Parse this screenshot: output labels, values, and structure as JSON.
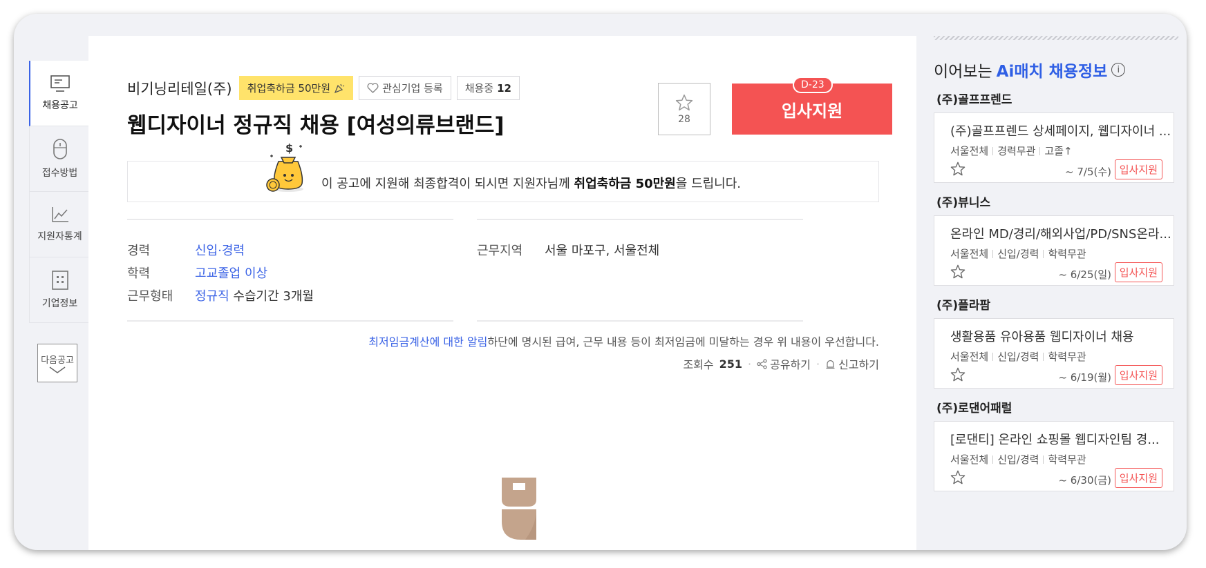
{
  "nav": {
    "items": [
      {
        "label": "채용공고",
        "icon": "monitor-icon"
      },
      {
        "label": "접수방법",
        "icon": "mouse-icon"
      },
      {
        "label": "지원자통계",
        "icon": "chart-icon"
      },
      {
        "label": "기업정보",
        "icon": "building-icon"
      }
    ],
    "next_label": "다음공고"
  },
  "job": {
    "company": "비기닝리테일(주)",
    "bonus_badge": "취업축하금 50만원",
    "interest_button": "관심기업 등록",
    "hiring_label": "채용중",
    "hiring_count": "12",
    "title": "웹디자이너 정규직 채용 [여성의류브랜드]",
    "scrap_count": "28",
    "dday": "D-23",
    "apply_label": "입사지원",
    "bonus_text_pre": "이 공고에 지원해 최종합격이 되시면 지원자님께 ",
    "bonus_text_bold": "취업축하금 50만원",
    "bonus_text_post": "을 드립니다."
  },
  "details": {
    "left": [
      {
        "label": "경력",
        "value": "신입·경력",
        "extra": ""
      },
      {
        "label": "학력",
        "value": "고교졸업 이상",
        "extra": ""
      },
      {
        "label": "근무형태",
        "value": "정규직",
        "extra": " 수습기간 3개월"
      }
    ],
    "right": [
      {
        "label": "근무지역",
        "value": "서울 마포구, 서울전체"
      }
    ]
  },
  "notice": {
    "link": "최저임금계산에 대한 알림",
    "text": "하단에 명시된 급여, 근무 내용 등이 최저임금에 미달하는 경우 위 내용이 우선합니다."
  },
  "stats": {
    "views_label": "조회수",
    "views": "251",
    "share": "공유하기",
    "report": "신고하기"
  },
  "sidebar": {
    "title_pre": "이어보는 ",
    "title_accent": "Ai매치 채용정보",
    "info_icon": "i",
    "items": [
      {
        "company": "(주)골프프렌드",
        "job": "(주)골프프렌드 상세페이지, 웹디자이너 ...",
        "tags": [
          "서울전체",
          "경력무관",
          "고졸↑"
        ],
        "date": "~ 7/5(수)",
        "apply": "입사지원"
      },
      {
        "company": "(주)뷰니스",
        "job": "온라인 MD/경리/해외사업/PD/SNS온라...",
        "tags": [
          "서울전체",
          "신입/경력",
          "학력무관"
        ],
        "date": "~ 6/25(일)",
        "apply": "입사지원"
      },
      {
        "company": "(주)플라팜",
        "job": "생활용품 유아용품 웹디자이너 채용",
        "tags": [
          "서울전체",
          "신입/경력",
          "학력무관"
        ],
        "date": "~ 6/19(월)",
        "apply": "입사지원"
      },
      {
        "company": "(주)로댄어패럴",
        "job": "[로댄티] 온라인 쇼핑몰 웹디자인팀 경...",
        "tags": [
          "서울전체",
          "신입/경력",
          "학력무관"
        ],
        "date": "~ 6/30(금)",
        "apply": "입사지원"
      }
    ]
  },
  "colors": {
    "accent": "#3b63e6",
    "apply": "#f45353",
    "bonus": "#ffe36b"
  }
}
